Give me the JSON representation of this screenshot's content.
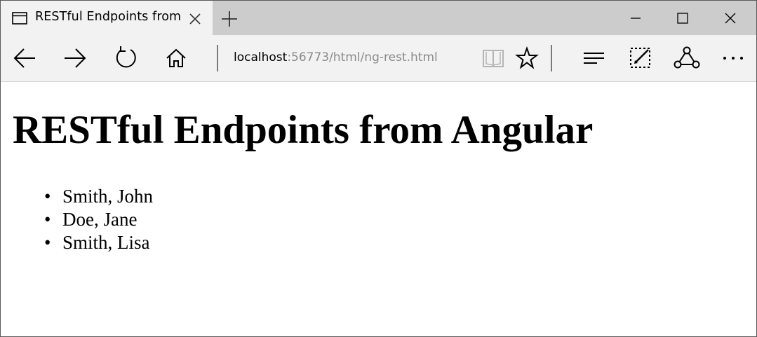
{
  "browser": {
    "tab": {
      "title": "RESTful Endpoints from",
      "icon": "page-icon",
      "close_icon": "close-icon"
    },
    "new_tab_icon": "plus-icon",
    "window_controls": [
      "minimize-icon",
      "maximize-icon",
      "close-icon"
    ],
    "nav": {
      "back_icon": "back-arrow-icon",
      "forward_icon": "forward-arrow-icon",
      "refresh_icon": "refresh-icon",
      "home_icon": "home-icon"
    },
    "address": {
      "host": "localhost",
      "rest": ":56773/html/ng-rest.html"
    },
    "toolbar_icons": [
      "reading-view-icon",
      "star-icon",
      "hub-icon",
      "web-note-icon",
      "share-icon",
      "more-icon"
    ]
  },
  "page": {
    "title": "RESTful Endpoints from Angular",
    "items": [
      "Smith, John",
      "Doe, Jane",
      "Smith, Lisa"
    ]
  }
}
